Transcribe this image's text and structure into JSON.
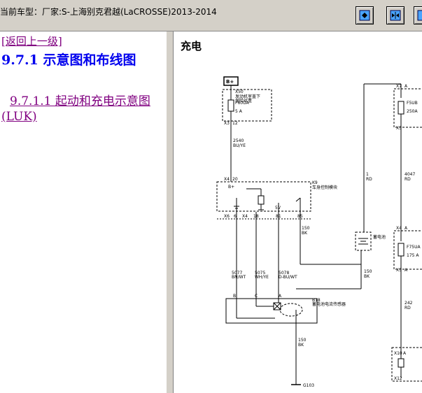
{
  "window": {
    "title": "当前车型：厂家:S-上海别克君越(LaCROSSE)2013-2014",
    "buttons": [
      "show-button",
      "expand-button",
      "collapse-button"
    ]
  },
  "nav": {
    "back_link": "[返回上一级]",
    "section_heading": "9.7.1 示意图和布线图",
    "sub_link": "9.7.1.1 起动和充电示意图 (LUK)"
  },
  "diagram": {
    "title": "充电",
    "labels": {
      "bplus_box": "B+",
      "x50": "X50",
      "x50_desc1": "发动机室盖下",
      "x50_desc2": "保险丝盒",
      "f60ua": "F60UA",
      "f60ua_rating": "5 A",
      "x3_left": "X3",
      "pin_12": "12",
      "w2540": "2540",
      "w2540_color": "BU/YE",
      "x4_top": "X4",
      "pin_20": "20",
      "k9": "K9",
      "k9_desc": "车身控制模块",
      "bplus_k9": "B+",
      "x6": "X6",
      "pin_6": "6",
      "x4_mid": "X4",
      "pin_18": "18",
      "pin_81": "81",
      "pin_85": "85",
      "sv": "5V",
      "w150_top": "150",
      "bk_top": "BK",
      "w5077": "5077",
      "w5077_color": "BN/WT",
      "w5075": "5075",
      "w5075_color": "WH/YE",
      "w5078": "5078",
      "w5078_color": "D-BU/WT",
      "pin_b": "B",
      "pin_c": "C",
      "pin_a": "A",
      "b18": "B18",
      "b18_desc": "蓄电池电流传感器",
      "w150_bot": "150",
      "bk_bot": "BK",
      "g103": "G103",
      "w1": "1",
      "rd1": "RD",
      "w150_right": "150",
      "bk_right": "BK",
      "battery_label": "蓄电池",
      "x7": "X7",
      "pin_a_x7": "A",
      "f5ub": "F5UB",
      "f5ub_rating": "250A",
      "x3_right": "X3",
      "w4047": "4047",
      "rd_4047": "RD",
      "x4_right": "X4",
      "pin_a_x4r": "A",
      "f75ua": "F75UA",
      "f75ua_rating": "175 A",
      "x3_right2": "X3",
      "pin_a_x3r": "A",
      "w242": "242",
      "rd_242": "RD",
      "x10": "X10",
      "pin_a_x10": "A",
      "x12": "X12"
    }
  }
}
